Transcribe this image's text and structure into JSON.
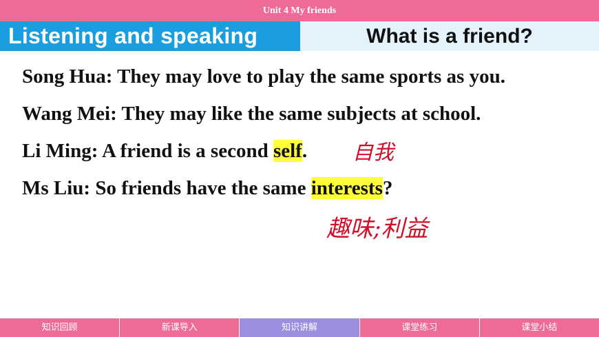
{
  "header": {
    "unit_title": "Unit 4 My friends"
  },
  "section": {
    "left_title": "Listening and speaking",
    "right_title": "What is a friend?"
  },
  "dialogue": [
    {
      "text": "Song Hua: They may love to play the same sports as you."
    },
    {
      "text": "Wang Mei: They may like the same subjects at school."
    },
    {
      "before": "Li Ming: A friend is a second ",
      "highlight": "self",
      "after": "."
    },
    {
      "before": "Ms Liu: So friends have the same ",
      "highlight": "interests",
      "after": "?"
    }
  ],
  "annotations": {
    "self_note": "自我",
    "interests_note": "趣味;利益"
  },
  "nav": {
    "items": [
      "知识回顾",
      "新课导入",
      "知识讲解",
      "课堂练习",
      "课堂小结"
    ],
    "active": "知识讲解"
  },
  "colors": {
    "topbar": "#ee6b95",
    "title_left_bg": "#1a9ee0",
    "title_right_bg": "#e3f2fb",
    "highlight": "#ffff3a",
    "annotation": "#d0102a",
    "nav_active": "#9b8ee0"
  }
}
